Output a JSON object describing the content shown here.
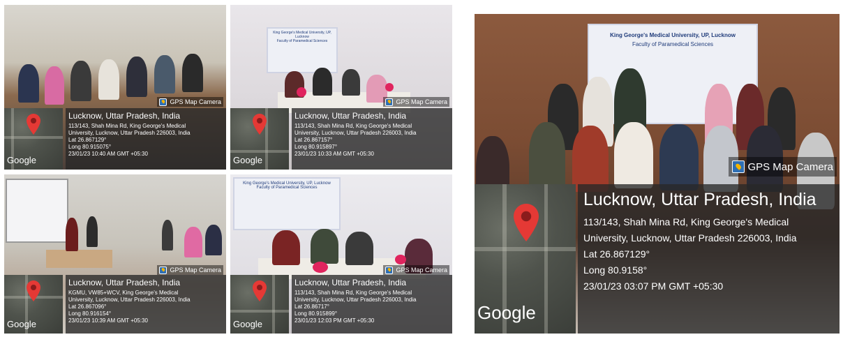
{
  "photos": [
    {
      "id": "p1",
      "badge": "GPS Map Camera",
      "city": "Lucknow, Uttar Pradesh, India",
      "address_1": "113/143, Shah Mina Rd, King George's Medical",
      "address_2": "University, Lucknow, Uttar Pradesh 226003, India",
      "lat": "Lat 26.867129°",
      "long": "Long 80.915075°",
      "datetime": "23/01/23 10:40 AM GMT +05:30",
      "map_brand": "Google"
    },
    {
      "id": "p2",
      "badge": "GPS Map Camera",
      "city": "Lucknow, Uttar Pradesh, India",
      "address_1": "113/143, Shah Mina Rd, King George's Medical",
      "address_2": "University, Lucknow, Uttar Pradesh 226003, India",
      "lat": "Lat 26.867157°",
      "long": "Long 80.915897°",
      "datetime": "23/01/23 10:33 AM GMT +05:30",
      "map_brand": "Google"
    },
    {
      "id": "p3",
      "badge": "GPS Map Camera",
      "city": "Lucknow, Uttar Pradesh, India",
      "address_1": "KGMU, VW85+WCV, King George's Medical",
      "address_2": "University, Lucknow, Uttar Pradesh 226003, India",
      "lat": "Lat 26.867096°",
      "long": "Long 80.916154°",
      "datetime": "23/01/23 10:39 AM GMT +05:30",
      "map_brand": "Google"
    },
    {
      "id": "p4",
      "badge": "GPS Map Camera",
      "city": "Lucknow, Uttar Pradesh, India",
      "address_1": "113/143, Shah Mina Rd, King George's Medical",
      "address_2": "University, Lucknow, Uttar Pradesh 226003, India",
      "lat": "Lat 26.86717°",
      "long": "Long 80.915899°",
      "datetime": "23/01/23 12:03 PM GMT +05:30",
      "map_brand": "Google"
    },
    {
      "id": "p5",
      "badge": "GPS Map Camera",
      "city": "Lucknow, Uttar Pradesh, India",
      "address_1": "113/143, Shah Mina Rd, King George's Medical",
      "address_2": "University, Lucknow, Uttar Pradesh 226003, India",
      "lat": "Lat 26.867129°",
      "long": "Long 80.9158°",
      "datetime": "23/01/23 03:07 PM GMT +05:30",
      "map_brand": "Google"
    }
  ],
  "banner": {
    "university": "King George's Medical University, UP, Lucknow",
    "faculty": "Faculty of Paramedical Sciences"
  },
  "colors": {
    "overlay": "#282828",
    "pin": "#e53935",
    "badge_icon": "#2f6fb4"
  }
}
